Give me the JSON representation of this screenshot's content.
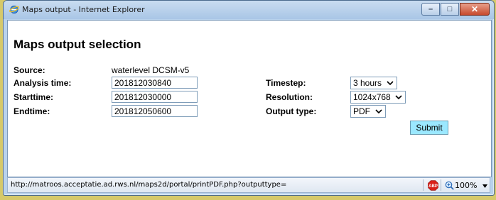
{
  "window": {
    "title": "Maps output - Internet Explorer",
    "buttons": {
      "minimize": "–",
      "maximize": "□",
      "close": "✕"
    }
  },
  "page": {
    "title": "Maps output selection",
    "source_label": "Source:",
    "source_value": "waterlevel DCSM-v5",
    "analysis_label": "Analysis time:",
    "analysis_value": "201812030840",
    "start_label": "Starttime:",
    "start_value": "201812030000",
    "end_label": "Endtime:",
    "end_value": "201812050600",
    "timestep_label": "Timestep:",
    "timestep_value": "3 hours",
    "resolution_label": "Resolution:",
    "resolution_value": "1024x768",
    "output_label": "Output type:",
    "output_value": "PDF",
    "submit_label": "Submit"
  },
  "statusbar": {
    "url": "http://matroos.acceptatie.ad.rws.nl/maps2d/portal/printPDF.php?outputtype=",
    "adblock_label": "ABP",
    "zoom": "100%"
  },
  "colors": {
    "desktop": "#d6c96a",
    "submit_bg": "#9be8ff",
    "abp_red": "#d9201a"
  }
}
